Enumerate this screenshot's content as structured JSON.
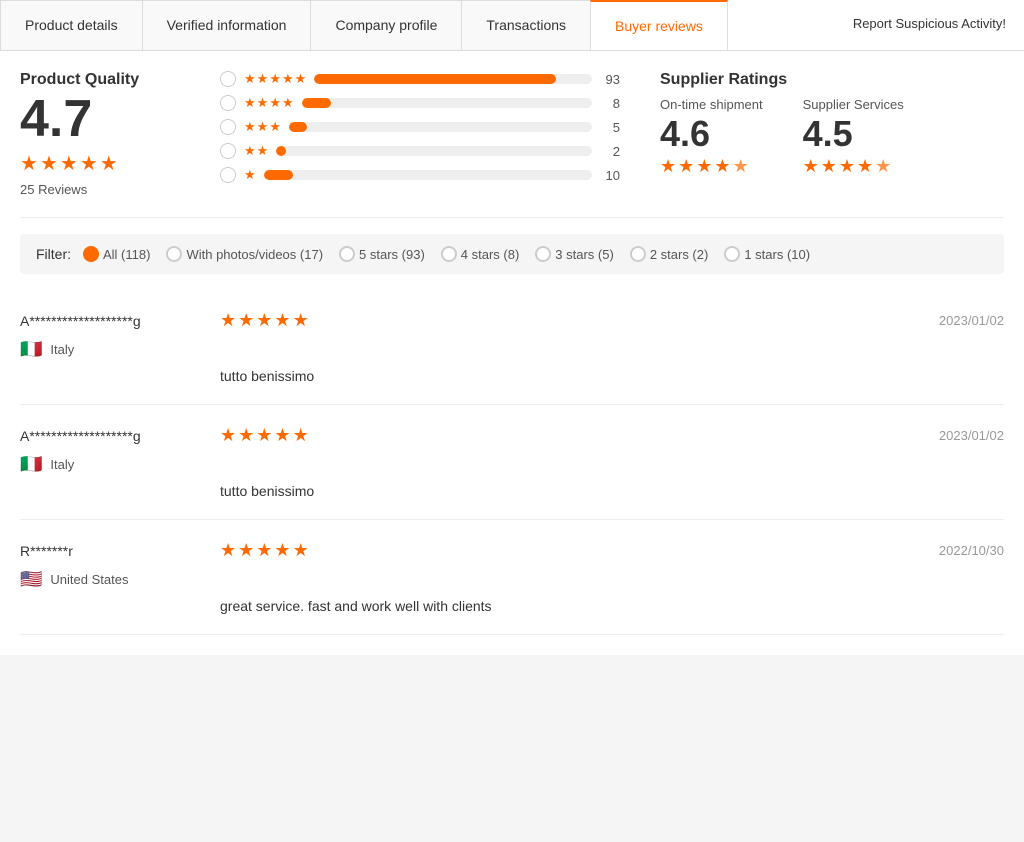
{
  "tabs": [
    {
      "id": "product-details",
      "label": "Product details",
      "active": false
    },
    {
      "id": "verified-information",
      "label": "Verified information",
      "active": false
    },
    {
      "id": "company-profile",
      "label": "Company profile",
      "active": false
    },
    {
      "id": "transactions",
      "label": "Transactions",
      "active": false
    },
    {
      "id": "buyer-reviews",
      "label": "Buyer reviews",
      "active": true
    }
  ],
  "report_button": "Report Suspicious Activity!",
  "product_quality": {
    "title": "Product Quality",
    "score": "4.7",
    "reviews_count": "25 Reviews",
    "stars": [
      1,
      1,
      1,
      1,
      0.7
    ]
  },
  "rating_bars": [
    {
      "stars": 5,
      "count": 93,
      "percent": 87
    },
    {
      "stars": 4,
      "count": 8,
      "percent": 10
    },
    {
      "stars": 3,
      "count": 5,
      "percent": 6
    },
    {
      "stars": 2,
      "count": 2,
      "percent": 3
    },
    {
      "stars": 1,
      "count": 10,
      "percent": 9
    }
  ],
  "supplier_ratings": {
    "title": "Supplier Ratings",
    "items": [
      {
        "label": "On-time shipment",
        "score": "4.6",
        "stars": [
          1,
          1,
          1,
          1,
          0.6
        ]
      },
      {
        "label": "Supplier Services",
        "score": "4.5",
        "stars": [
          1,
          1,
          1,
          1,
          0.5
        ]
      }
    ]
  },
  "filter": {
    "label": "Filter:",
    "options": [
      {
        "id": "all",
        "label": "All (118)",
        "selected": true
      },
      {
        "id": "photos",
        "label": "With photos/videos (17)",
        "selected": false
      },
      {
        "id": "5stars",
        "label": "5 stars (93)",
        "selected": false
      },
      {
        "id": "4stars",
        "label": "4 stars (8)",
        "selected": false
      },
      {
        "id": "3stars",
        "label": "3 stars (5)",
        "selected": false
      },
      {
        "id": "2stars",
        "label": "2 stars (2)",
        "selected": false
      },
      {
        "id": "1stars",
        "label": "1 stars (10)",
        "selected": false
      }
    ]
  },
  "reviews": [
    {
      "name": "A*******************g",
      "stars": 5,
      "date": "2023/01/02",
      "country_flag": "🇮🇹",
      "country": "Italy",
      "text": "tutto benissimo"
    },
    {
      "name": "A*******************g",
      "stars": 5,
      "date": "2023/01/02",
      "country_flag": "🇮🇹",
      "country": "Italy",
      "text": "tutto benissimo"
    },
    {
      "name": "R*******r",
      "stars": 5,
      "date": "2022/10/30",
      "country_flag": "🇺🇸",
      "country": "United States",
      "text": "great service. fast and work well with clients"
    }
  ]
}
